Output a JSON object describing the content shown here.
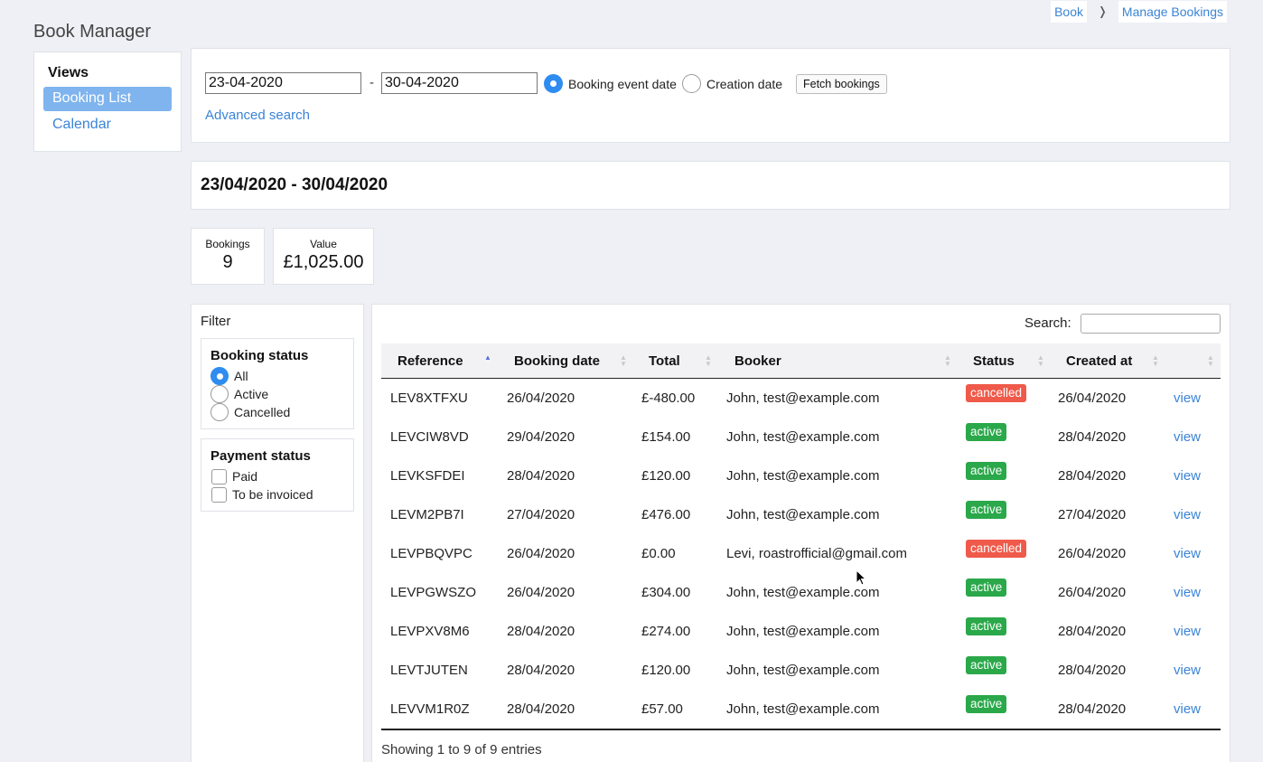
{
  "app": {
    "title": "Book Manager"
  },
  "breadcrumb": {
    "items": [
      "Book",
      "Manage Bookings"
    ],
    "separator": "❭"
  },
  "views": {
    "title": "Views",
    "items": [
      {
        "label": "Booking List",
        "active": true
      },
      {
        "label": "Calendar",
        "active": false
      }
    ]
  },
  "search": {
    "from_date": "23-04-2020",
    "to_date": "30-04-2020",
    "dash": "-",
    "date_type_options": [
      {
        "label": "Booking event date",
        "checked": true
      },
      {
        "label": "Creation date",
        "checked": false
      }
    ],
    "fetch_label": "Fetch bookings",
    "advanced_label": "Advanced search"
  },
  "range": {
    "title": "23/04/2020 - 30/04/2020"
  },
  "stats": {
    "bookings_label": "Bookings",
    "bookings_value": "9",
    "value_label": "Value",
    "value_value": "£1,025.00"
  },
  "filter": {
    "title": "Filter",
    "booking_status": {
      "title": "Booking status",
      "options": [
        {
          "label": "All",
          "checked": true
        },
        {
          "label": "Active",
          "checked": false
        },
        {
          "label": "Cancelled",
          "checked": false
        }
      ]
    },
    "payment_status": {
      "title": "Payment status",
      "options": [
        {
          "label": "Paid",
          "checked": false
        },
        {
          "label": "To be invoiced",
          "checked": false
        }
      ]
    }
  },
  "table": {
    "search_label": "Search:",
    "search_value": "",
    "columns": [
      "Reference",
      "Booking date",
      "Total",
      "Booker",
      "Status",
      "Created at",
      ""
    ],
    "sorted_column": "Reference",
    "sort_direction": "asc",
    "rows": [
      {
        "reference": "LEV8XTFXU",
        "booking_date": "26/04/2020",
        "total": "£-480.00",
        "booker": "John, test@example.com",
        "status": "cancelled",
        "created_at": "26/04/2020",
        "action": "view"
      },
      {
        "reference": "LEVCIW8VD",
        "booking_date": "29/04/2020",
        "total": "£154.00",
        "booker": "John, test@example.com",
        "status": "active",
        "created_at": "28/04/2020",
        "action": "view"
      },
      {
        "reference": "LEVKSFDEI",
        "booking_date": "28/04/2020",
        "total": "£120.00",
        "booker": "John, test@example.com",
        "status": "active",
        "created_at": "28/04/2020",
        "action": "view"
      },
      {
        "reference": "LEVM2PB7I",
        "booking_date": "27/04/2020",
        "total": "£476.00",
        "booker": "John, test@example.com",
        "status": "active",
        "created_at": "27/04/2020",
        "action": "view"
      },
      {
        "reference": "LEVPBQVPC",
        "booking_date": "26/04/2020",
        "total": "£0.00",
        "booker": "Levi, roastrofficial@gmail.com",
        "status": "cancelled",
        "created_at": "26/04/2020",
        "action": "view"
      },
      {
        "reference": "LEVPGWSZO",
        "booking_date": "26/04/2020",
        "total": "£304.00",
        "booker": "John, test@example.com",
        "status": "active",
        "created_at": "26/04/2020",
        "action": "view"
      },
      {
        "reference": "LEVPXV8M6",
        "booking_date": "28/04/2020",
        "total": "£274.00",
        "booker": "John, test@example.com",
        "status": "active",
        "created_at": "28/04/2020",
        "action": "view"
      },
      {
        "reference": "LEVTJUTEN",
        "booking_date": "28/04/2020",
        "total": "£120.00",
        "booker": "John, test@example.com",
        "status": "active",
        "created_at": "28/04/2020",
        "action": "view"
      },
      {
        "reference": "LEVVM1R0Z",
        "booking_date": "28/04/2020",
        "total": "£57.00",
        "booker": "John, test@example.com",
        "status": "active",
        "created_at": "28/04/2020",
        "action": "view"
      }
    ],
    "info": "Showing 1 to 9 of 9 entries"
  },
  "colors": {
    "accent": "#3a84d6",
    "active_view_bg": "#7fb4ee",
    "status_active": "#2aa84a",
    "status_cancelled": "#ef5a4a",
    "page_bg": "#eef0f5"
  }
}
